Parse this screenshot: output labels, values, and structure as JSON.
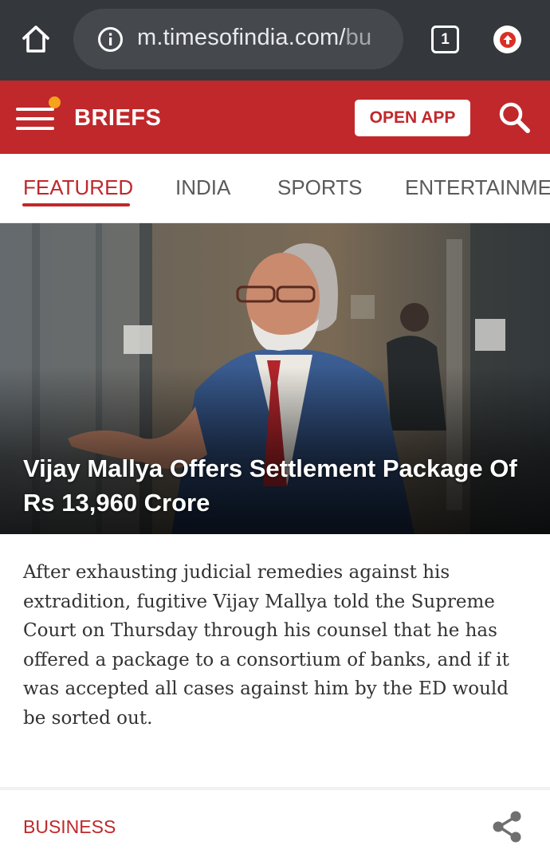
{
  "browser": {
    "url_visible": "m.timesofindia.com/",
    "url_faded": "bu",
    "tab_count": "1"
  },
  "header": {
    "brand": "BRIEFS",
    "open_app_label": "OPEN APP"
  },
  "category_tabs": [
    {
      "label": "FEATURED",
      "active": true
    },
    {
      "label": "INDIA",
      "active": false
    },
    {
      "label": "SPORTS",
      "active": false
    },
    {
      "label": "ENTERTAINMENT",
      "active": false
    }
  ],
  "story": {
    "headline": "Vijay Mallya Offers Settlement Package Of Rs 13,960 Crore",
    "summary": "After exhausting judicial remedies against his extradition, fugitive Vijay Mallya told the Supreme Court on Thursday through his counsel that he has offered a package to a consortium of banks, and if it was accepted all cases against him by the ED would be sorted out.",
    "category": "BUSINESS"
  },
  "colors": {
    "brand_red": "#c0282b",
    "chrome_dark": "#34373b",
    "notification_dot": "#f5a31c"
  },
  "icons": [
    "home-icon",
    "info-icon",
    "tab-switcher-icon",
    "update-icon",
    "hamburger-menu-icon",
    "search-icon",
    "share-icon"
  ]
}
